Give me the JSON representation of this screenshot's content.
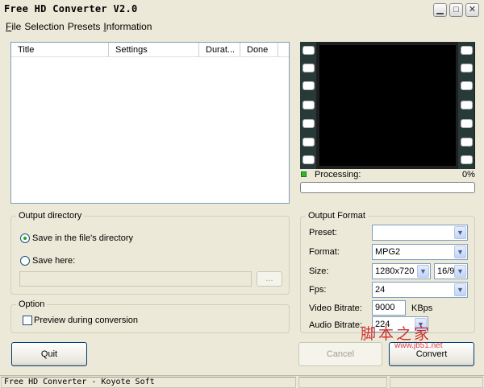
{
  "window": {
    "title": "Free HD Converter V2.0",
    "controls": {
      "minimize": "▁",
      "maximize": "□",
      "close": "✕"
    }
  },
  "menu": [
    {
      "label": "File",
      "access": "F",
      "rest": "ile"
    },
    {
      "label": "Selection",
      "access": "",
      "rest": "Selection"
    },
    {
      "label": "Presets",
      "access": "",
      "rest": "Presets"
    },
    {
      "label": "Information",
      "access": "I",
      "rest": "nformation"
    }
  ],
  "file_list": {
    "columns": [
      "Title",
      "Settings",
      "Durat...",
      "Done"
    ],
    "rows": []
  },
  "preview": {
    "processing_label": "Processing:",
    "progress_text": "0%",
    "progress": 0
  },
  "output_directory": {
    "group_title": "Output directory",
    "option_file_dir": "Save in the file's directory",
    "option_save_here": "Save here:",
    "selected": "file_dir",
    "path_value": "",
    "browse_label": "..."
  },
  "option": {
    "group_title": "Option",
    "preview_during_conversion": "Preview during conversion",
    "preview_checked": false
  },
  "output_format": {
    "group_title": "Output Format",
    "preset_label": "Preset:",
    "preset_value": "",
    "format_label": "Format:",
    "format_value": "MPG2",
    "size_label": "Size:",
    "size_value": "1280x720",
    "aspect_value": "16/9",
    "fps_label": "Fps:",
    "fps_value": "24",
    "video_bitrate_label": "Video Bitrate:",
    "video_bitrate_value": "9000",
    "video_bitrate_unit": "KBps",
    "audio_bitrate_label": "Audio Bitrate:",
    "audio_bitrate_value": "224"
  },
  "buttons": {
    "quit": "Quit",
    "cancel": "Cancel",
    "convert": "Convert"
  },
  "status": {
    "left": "Free HD Converter - Koyote Soft",
    "middle": "",
    "right": ""
  },
  "watermark": {
    "text": "脚本之家",
    "url": "www.jb51.net"
  },
  "colors": {
    "window_bg": "#ece9d8",
    "progress_ok": "#32b529",
    "watermark": "#c91c1c"
  }
}
